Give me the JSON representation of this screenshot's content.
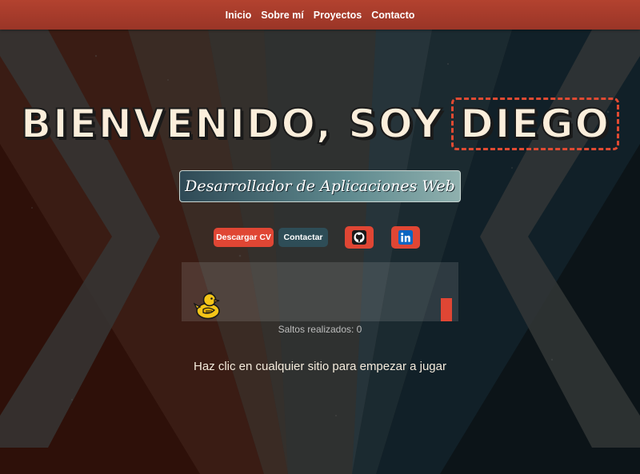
{
  "nav": {
    "items": [
      "Inicio",
      "Sobre mí",
      "Proyectos",
      "Contacto"
    ]
  },
  "hero": {
    "title_prefix": "BIENVENIDO, SOY",
    "title_name": "DIEGO",
    "subtitle": "Desarrollador de Aplicaciones Web"
  },
  "actions": {
    "download_cv": "Descargar CV",
    "contact": "Contactar",
    "github_icon": "github-icon",
    "linkedin_icon": "linkedin-icon"
  },
  "game": {
    "jumps_label": "Saltos realizados: 0",
    "play_hint": "Haz clic en cualquier sitio para empezar a jugar"
  },
  "colors": {
    "accent_red": "#e04634",
    "nav_bg": "#a83c2c",
    "teal_dark": "#2e4d57",
    "title_cream": "#fbeedb",
    "duck_yellow": "#f5c518"
  }
}
